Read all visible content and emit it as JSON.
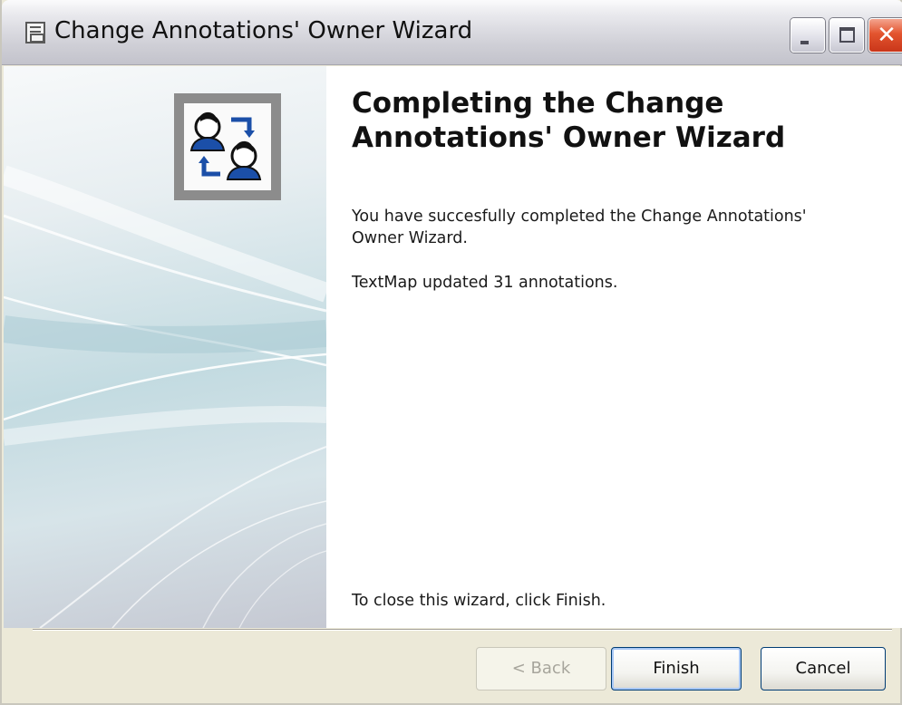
{
  "window": {
    "title": "Change Annotations' Owner Wizard",
    "icon": "wizard-app-icon",
    "controls": {
      "minimize": "minimize-icon",
      "maximize": "maximize-icon",
      "close": "close-icon",
      "close_glyph": "✕"
    }
  },
  "page": {
    "heading": "Completing the Change Annotations' Owner Wizard",
    "message": "You have succesfully completed the Change Annotations' Owner Wizard.",
    "result": "TextMap updated 31 annotations.",
    "close_hint": "To close this wizard, click Finish.",
    "icon": "change-owner-icon"
  },
  "buttons": {
    "back": "< Back",
    "finish": "Finish",
    "cancel": "Cancel"
  },
  "colors": {
    "accent_border": "#003c74",
    "close_button": "#e3542e",
    "disabled_text": "#a7a59c"
  }
}
